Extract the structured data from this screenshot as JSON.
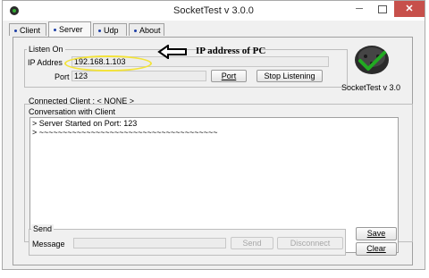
{
  "window": {
    "title": "SocketTest v 3.0.0",
    "min_glyph": "─",
    "close_glyph": "✕"
  },
  "tabs": [
    {
      "label": "Client"
    },
    {
      "label": "Server"
    },
    {
      "label": "Udp"
    },
    {
      "label": "About"
    }
  ],
  "listen": {
    "legend": "Listen On",
    "ip_label": "IP Addres",
    "ip_value": "192.168.1.103",
    "port_label": "Port",
    "port_value": "123",
    "port_button": "Port",
    "stop_button": "Stop Listening"
  },
  "annotation": {
    "text": "IP address of PC"
  },
  "logo": {
    "caption": "SocketTest v 3.0"
  },
  "status": {
    "connected_client": "Connected Client : < NONE >"
  },
  "conversation": {
    "legend": "Conversation with Client",
    "lines": [
      "> Server Started on Port: 123",
      "> ~~~~~~~~~~~~~~~~~~~~~~~~~~~~~~~~~~~~~~"
    ]
  },
  "send": {
    "legend": "Send",
    "message_label": "Message",
    "message_value": "",
    "send_button": "Send",
    "disconnect_button": "Disconnect"
  },
  "actions": {
    "save_button": "Save",
    "clear_button": "Clear"
  },
  "colors": {
    "close_button": "#c7504b",
    "highlight": "#f3e33a",
    "tab_dot": "#1c3ea6",
    "logo_check": "#22aa22"
  }
}
